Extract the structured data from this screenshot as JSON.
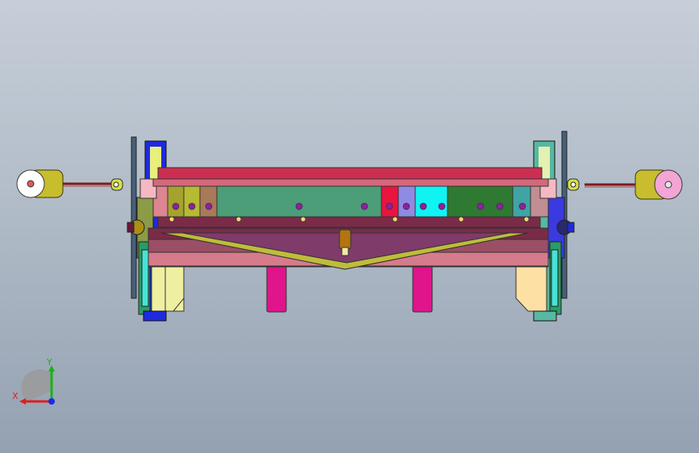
{
  "window": {
    "title": ""
  },
  "triad": {
    "x_label": "X",
    "y_label": "Y",
    "x_color": "#dd1f1f",
    "y_color": "#17b317",
    "z_color": "#1f2adf"
  },
  "colors": {
    "background_top": "#c6ced8",
    "background_bottom": "#94a1b1",
    "top_blade": "#cc2e51",
    "main_beam": "#9a4f66",
    "knife_holder": "#bfbc3c",
    "legs_center": "#e0158b",
    "legs_side": "#f7e7a6",
    "counterweights": "#cfcf2f",
    "roller_pink": "#f3a5d6"
  }
}
